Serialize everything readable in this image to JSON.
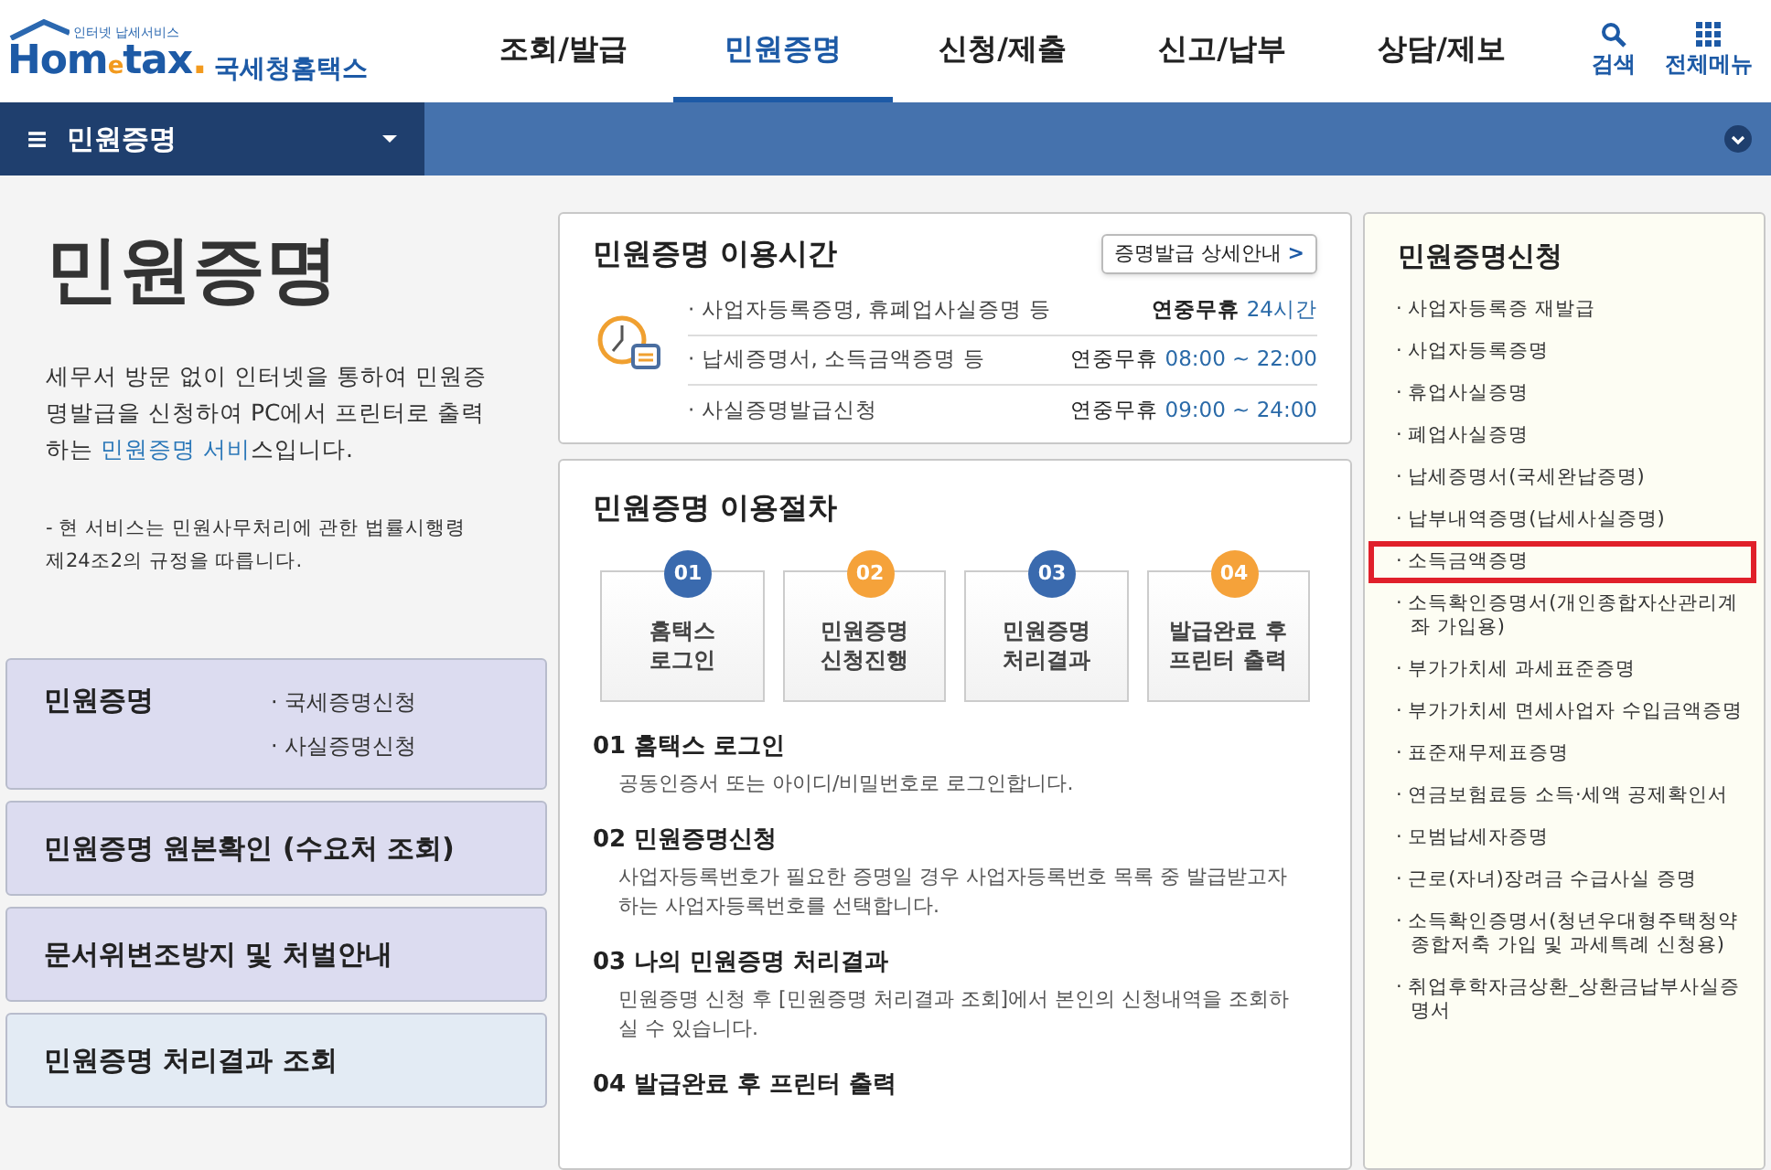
{
  "header": {
    "logo_tagline": "인터넷 납세서비스",
    "logo_word_a": "Hom",
    "logo_word_e": "e",
    "logo_word_b": "tax",
    "logo_dot": ".",
    "logo_name": "국세청홈택스",
    "menu": [
      {
        "label": "조회/발급",
        "selected": false
      },
      {
        "label": "민원증명",
        "selected": true
      },
      {
        "label": "신청/제출",
        "selected": false
      },
      {
        "label": "신고/납부",
        "selected": false
      },
      {
        "label": "상담/제보",
        "selected": false
      }
    ],
    "search_label": "검색",
    "all_menu_label": "전체메뉴"
  },
  "nav": {
    "menu_glyph": "≡",
    "title": "민원증명"
  },
  "intro": {
    "title": "민원증명",
    "description": "세무서 방문 없이 인터넷을 통하여 민원증명발급을 신청하여 PC에서 프린터로 출력하는 ",
    "description_link": "민원증명 서비",
    "description_end": "스입니다.",
    "note": "- 현 서비스는 민원사무처리에 관한 법률시행령 제24조2의 규정을 따릅니다."
  },
  "side_cards": [
    {
      "kind": "primary",
      "title": "민원증명",
      "links": [
        "· 국세증명신청",
        "· 사실증명신청"
      ]
    },
    {
      "kind": "primary",
      "title": "민원증명 원본확인 (수요처 조회)"
    },
    {
      "kind": "primary",
      "title": "문서위변조방지 및 처벌안내"
    },
    {
      "kind": "secondary",
      "title": "민원증명 처리결과 조회"
    }
  ],
  "hours": {
    "title": "민원증명 이용시간",
    "detail_button": "증명발급 상세안내",
    "detail_arrow": ">",
    "rows": [
      {
        "label": "· 사업자등록증명, 휴폐업사실증명 등",
        "prefix": "연중무휴",
        "time": "24시간",
        "bold": true
      },
      {
        "label": "· 납세증명서, 소득금액증명 등",
        "prefix": "연중무휴",
        "time": "08:00 ~ 22:00",
        "bold": false
      },
      {
        "label": "· 사실증명발급신청",
        "prefix": "연중무휴",
        "time": "09:00 ~ 24:00",
        "bold": false
      }
    ]
  },
  "procedure": {
    "title": "민원증명 이용절차",
    "steps": [
      {
        "number": "01",
        "color": "#3a6aae",
        "lines": [
          "홈택스",
          "로그인"
        ]
      },
      {
        "number": "02",
        "color": "#f5a23a",
        "lines": [
          "민원증명",
          "신청진행"
        ]
      },
      {
        "number": "03",
        "color": "#3a6aae",
        "lines": [
          "민원증명",
          "처리결과"
        ]
      },
      {
        "number": "04",
        "color": "#f5a23a",
        "lines": [
          "발급완료 후",
          "프린터 출력"
        ]
      }
    ],
    "sections": [
      {
        "heading": "01 홈택스 로그인",
        "text": "공동인증서 또는 아이디/비밀번호로 로그인합니다."
      },
      {
        "heading": "02 민원증명신청",
        "text": "사업자등록번호가 필요한 증명일 경우 사업자등록번호 목록 중 발급받고자 하는 사업자등록번호를 선택합니다."
      },
      {
        "heading": "03 나의 민원증명 처리결과",
        "text": "민원증명 신청 후 [민원증명 처리결과 조회]에서 본인의 신청내역을 조회하실 수 있습니다."
      },
      {
        "heading": "04 발급완료 후 프린터 출력"
      }
    ]
  },
  "apply": {
    "title": "민원증명신청",
    "items": [
      {
        "label": "· 사업자등록증 재발급",
        "highlighted": false
      },
      {
        "label": "· 사업자등록증명",
        "highlighted": false
      },
      {
        "label": "· 휴업사실증명",
        "highlighted": false
      },
      {
        "label": "· 폐업사실증명",
        "highlighted": false
      },
      {
        "label": "· 납세증명서(국세완납증명)",
        "highlighted": false
      },
      {
        "label": "· 납부내역증명(납세사실증명)",
        "highlighted": false
      },
      {
        "label": "· 소득금액증명",
        "highlighted": true
      },
      {
        "label": "· 소득확인증명서(개인종합자산관리계좌 가입용)",
        "highlighted": false
      },
      {
        "label": "· 부가가치세 과세표준증명",
        "highlighted": false
      },
      {
        "label": "· 부가가치세 면세사업자 수입금액증명",
        "highlighted": false
      },
      {
        "label": "· 표준재무제표증명",
        "highlighted": false
      },
      {
        "label": "· 연금보험료등 소득·세액 공제확인서",
        "highlighted": false
      },
      {
        "label": "· 모범납세자증명",
        "highlighted": false
      },
      {
        "label": "· 근로(자녀)장려금 수급사실 증명",
        "highlighted": false
      },
      {
        "label": "· 소득확인증명서(청년우대형주택청약종합저축 가입 및 과세특례 신청용)",
        "highlighted": false
      },
      {
        "label": "· 취업후학자금상환_상환금납부사실증명서",
        "highlighted": false
      }
    ]
  }
}
